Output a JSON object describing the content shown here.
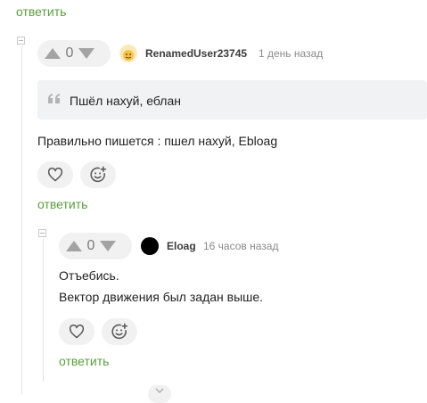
{
  "top_reply_link": "ответить",
  "comment1": {
    "score": "0",
    "username": "RenamedUser23745",
    "time": "1 день назад",
    "quote": "Пшёл нахуй, еблан",
    "body": "Правильно пишется : пшел нахуй, Ebloag",
    "reply_label": "ответить",
    "icons": [
      "heart-icon",
      "emoji-add-icon"
    ]
  },
  "comment2": {
    "score": "0",
    "username": "Eloag",
    "time": "16 часов назад",
    "body_lines": [
      "Отъебись.",
      "Вектор движения был задан выше."
    ],
    "reply_label": "ответить",
    "avatar_color": "#000000",
    "icons": [
      "heart-icon",
      "emoji-add-icon"
    ]
  },
  "colors": {
    "link": "#5b9e3e",
    "pill_bg": "#f1f1f1",
    "quote_bg": "#f1f2f3",
    "avatar1_bg": "#f7d37a"
  }
}
